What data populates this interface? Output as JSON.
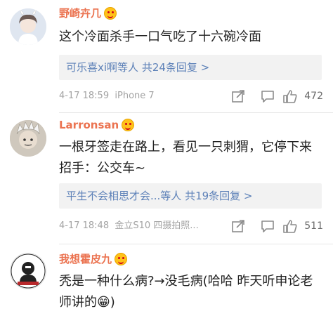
{
  "comments": [
    {
      "username": "野崎卉几",
      "text": "这个冷面杀手一口气吃了十六碗冷面",
      "reply_summary": "可乐喜xi啊等人  共24条回复 >",
      "time": "4-17 18:59",
      "device": "iPhone 7",
      "likes": "472"
    },
    {
      "username": "Larronsan",
      "text": "一根牙签走在路上，看见一只刺猬，它停下来招手：公交车~",
      "reply_summary": "平生不会相思才会...等人  共19条回复 >",
      "time": "4-17 18:48",
      "device": "金立S10 四摄拍照...",
      "likes": "511"
    },
    {
      "username": "我想霍皮九",
      "text": "秃是一种什么病?→没毛病(哈哈  昨天听申论老师讲的😁)"
    }
  ],
  "colors": {
    "username": "#eb7350",
    "link": "#5d81b8",
    "meta": "#a3a3a3"
  },
  "icons": [
    "share-icon",
    "comment-icon",
    "thumb-up-icon",
    "vip-badge-icon"
  ]
}
